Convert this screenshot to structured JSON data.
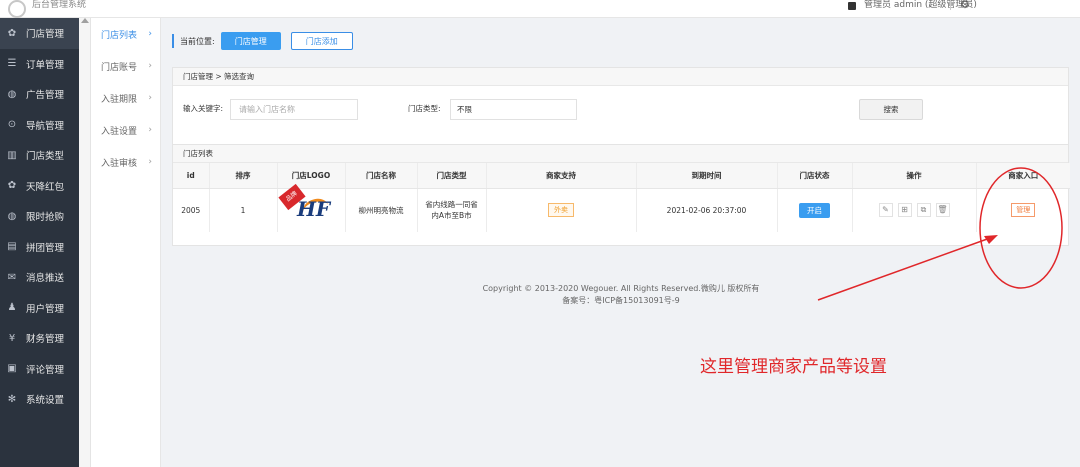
{
  "header": {
    "brand": "后台管理系统",
    "user": "管理员 admin (超级管理员)",
    "settings_icon": "gear-icon"
  },
  "sidebar": {
    "items": [
      {
        "label": "门店管理",
        "icon": "store-icon",
        "glyph": "✿",
        "active": true
      },
      {
        "label": "订单管理",
        "icon": "list-icon",
        "glyph": "☰"
      },
      {
        "label": "广告管理",
        "icon": "ad-icon",
        "glyph": "◍"
      },
      {
        "label": "导航管理",
        "icon": "compass-icon",
        "glyph": "⊙"
      },
      {
        "label": "门店类型",
        "icon": "building-icon",
        "glyph": "▥"
      },
      {
        "label": "天降红包",
        "icon": "gift-icon",
        "glyph": "✿"
      },
      {
        "label": "限时抢购",
        "icon": "timer-icon",
        "glyph": "◍"
      },
      {
        "label": "拼团管理",
        "icon": "group-icon",
        "glyph": "▤"
      },
      {
        "label": "消息推送",
        "icon": "message-icon",
        "glyph": "✉"
      },
      {
        "label": "用户管理",
        "icon": "user-icon",
        "glyph": "♟"
      },
      {
        "label": "财务管理",
        "icon": "yen-icon",
        "glyph": "¥"
      },
      {
        "label": "评论管理",
        "icon": "comment-icon",
        "glyph": "▣"
      },
      {
        "label": "系统设置",
        "icon": "gear-icon",
        "glyph": "✻"
      }
    ]
  },
  "submenu": {
    "items": [
      {
        "label": "门店列表",
        "active": true
      },
      {
        "label": "门店账号"
      },
      {
        "label": "入驻期限"
      },
      {
        "label": "入驻设置"
      },
      {
        "label": "入驻审核"
      }
    ],
    "chevron": "›"
  },
  "crumb": {
    "label": "当前位置:",
    "primary": "门店管理",
    "secondary": "门店添加"
  },
  "filter": {
    "title": "门店管理 > 筛选查询",
    "keyword_label": "输入关键字:",
    "keyword_placeholder": "请输入门店名称",
    "type_label": "门店类型:",
    "type_value": "不限",
    "search_label": "搜索"
  },
  "list": {
    "title": "门店列表",
    "columns": [
      "id",
      "排序",
      "门店LOGO",
      "门店名称",
      "门店类型",
      "商家支持",
      "到期时间",
      "门店状态",
      "操作",
      "商家入口"
    ],
    "rows": [
      {
        "id": "2005",
        "sort": "1",
        "logo_text": "HF",
        "logo_ribbon": "品牌",
        "name": "柳州明亮物流",
        "type": "省内线路一同省内A市至B市",
        "support": "外卖",
        "expire": "2021-02-06 20:37:00",
        "status": "开启",
        "ops": [
          "✎",
          "⊞",
          "⧉",
          "🗑"
        ],
        "entry": "管理"
      }
    ]
  },
  "footer": {
    "copyright": "Copyright © 2013-2020 Wegouer. All Rights Reserved.微购儿 版权所有",
    "icp": "备案号：粤ICP备15013091号-9"
  },
  "annotation": {
    "text": "这里管理商家产品等设置",
    "color": "#e0272a"
  }
}
